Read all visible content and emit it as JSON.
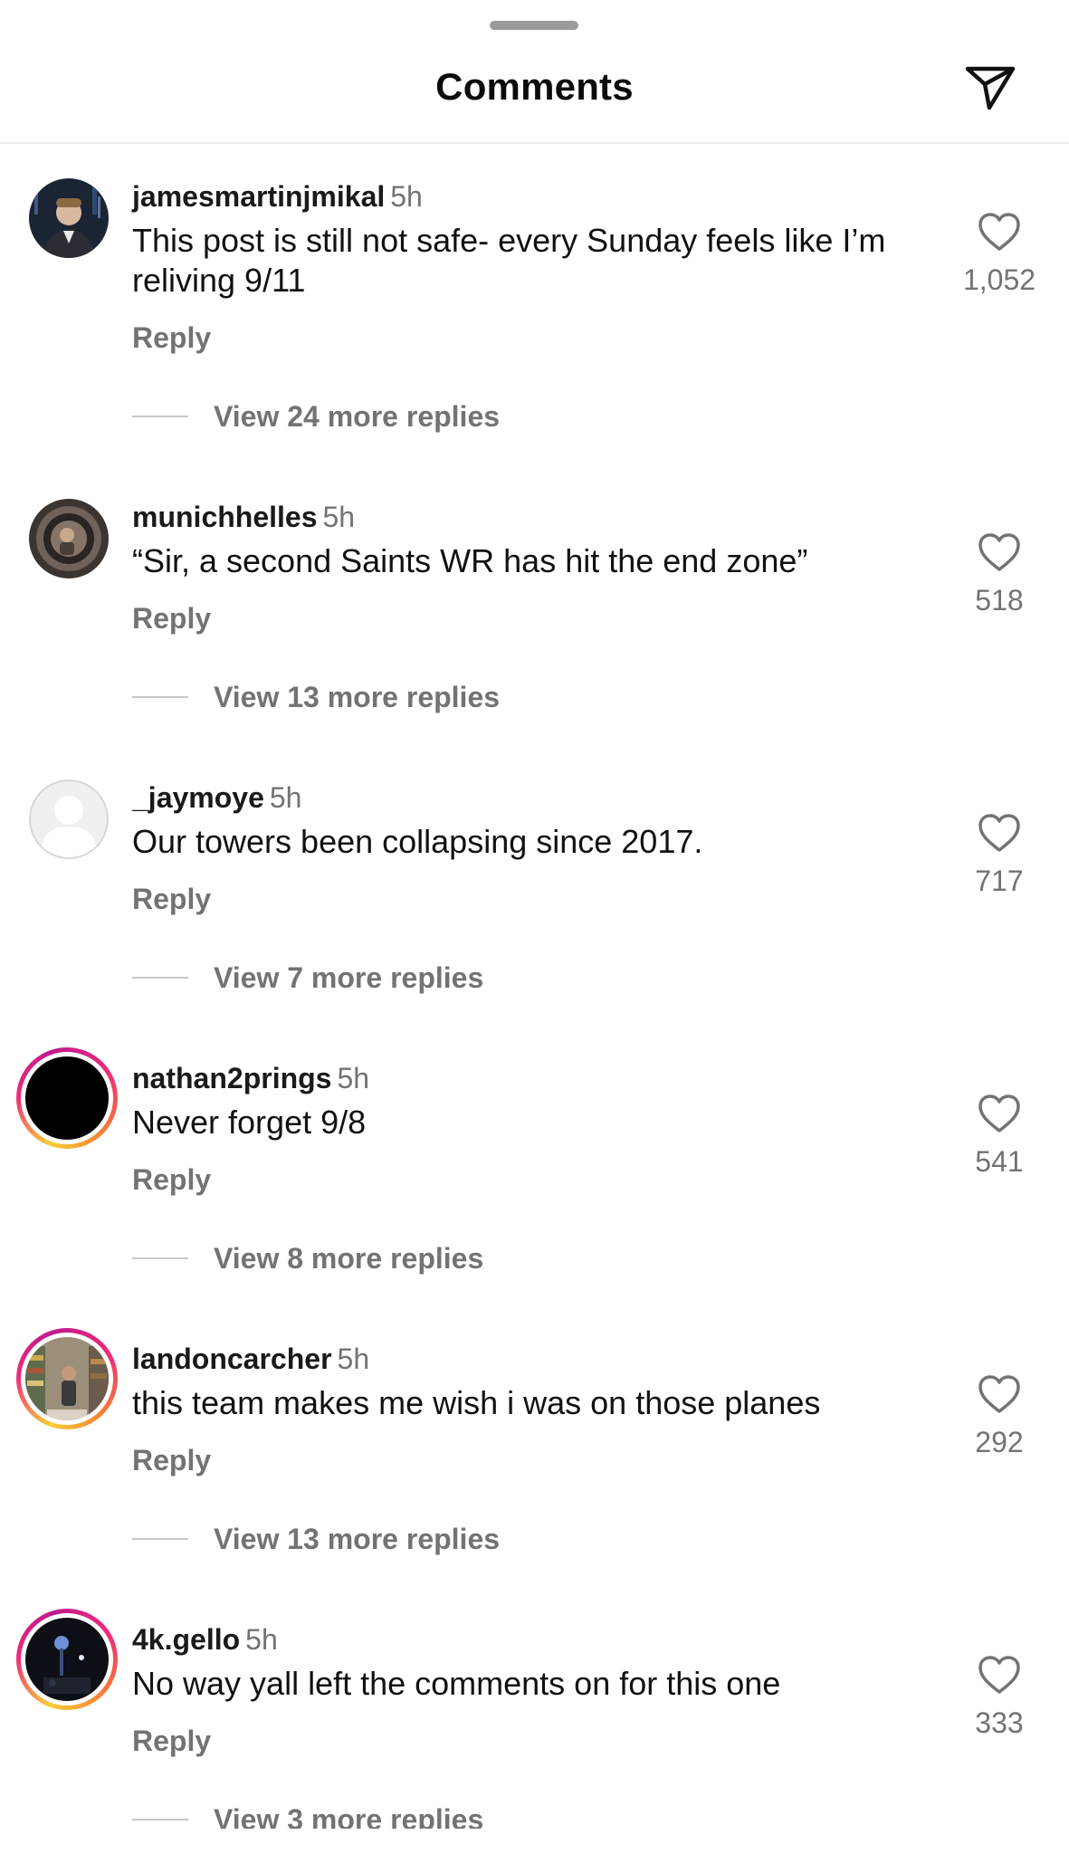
{
  "header": {
    "title": "Comments",
    "share_icon": "paper-plane-icon"
  },
  "comments": [
    {
      "username": "jamesmartinjmikal",
      "time": "5h",
      "text": "This post is still not safe- every Sunday feels like I’m reliving 9/11",
      "reply_label": "Reply",
      "likes": "1,052",
      "view_replies": "View 24 more replies",
      "avatar": "photo"
    },
    {
      "username": "munichhelles",
      "time": "5h",
      "text": "“Sir, a second Saints WR has hit the end zone”",
      "reply_label": "Reply",
      "likes": "518",
      "view_replies": "View 13 more replies",
      "avatar": "photo"
    },
    {
      "username": "_jaymoye",
      "time": "5h",
      "text": "Our towers been collapsing since 2017.",
      "reply_label": "Reply",
      "likes": "717",
      "view_replies": "View 7 more replies",
      "avatar": "default-placeholder"
    },
    {
      "username": "nathan2prings",
      "time": "5h",
      "text": "Never forget 9/8",
      "reply_label": "Reply",
      "likes": "541",
      "view_replies": "View 8 more replies",
      "avatar": "story-ring"
    },
    {
      "username": "landoncarcher",
      "time": "5h",
      "text": "this team makes me wish i was on those planes",
      "reply_label": "Reply",
      "likes": "292",
      "view_replies": "View 13 more replies",
      "avatar": "story-ring"
    },
    {
      "username": "4k.gello",
      "time": "5h",
      "text": "No way yall left the comments on for this one",
      "reply_label": "Reply",
      "likes": "333",
      "view_replies": "View 3 more replies",
      "avatar": "story-ring"
    }
  ],
  "colors": {
    "username": "#1a1a1a",
    "secondary_text": "#737373",
    "story_ring_start": "#f9ce34",
    "story_ring_mid": "#ee2a7b",
    "divider": "#eeeeee"
  }
}
